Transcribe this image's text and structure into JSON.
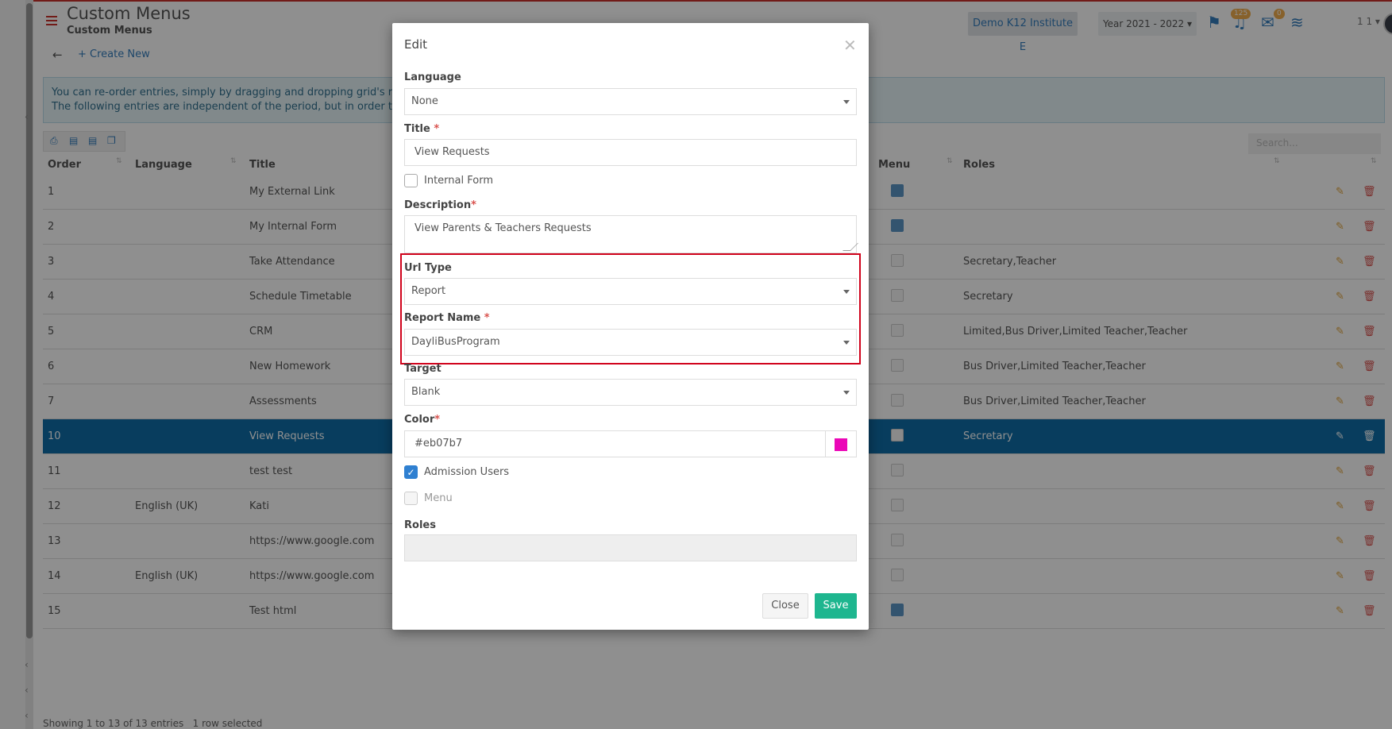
{
  "header": {
    "title": "Custom Menus",
    "subtitle": "Custom Menus",
    "institute": "Demo K12 Institute E",
    "year": "Year 2021 - 2022",
    "notif_count": "125",
    "mail_count": "0",
    "user_count": "1 1"
  },
  "toolbar": {
    "create_new": "Create New"
  },
  "info": {
    "line1": "You can re-order entries, simply by dragging and dropping grid's rows.",
    "line2": "The following entries are independent of the period, but in order to appea"
  },
  "search": {
    "placeholder": "Search..."
  },
  "grid": {
    "columns": [
      "Order",
      "Language",
      "Title",
      "Menu",
      "Roles"
    ],
    "rows": [
      {
        "order": "1",
        "language": "",
        "title": "My External Link",
        "menu": true,
        "roles": ""
      },
      {
        "order": "2",
        "language": "",
        "title": "My Internal Form",
        "menu": true,
        "roles": ""
      },
      {
        "order": "3",
        "language": "",
        "title": "Take Attendance",
        "menu": false,
        "roles": "Secretary,Teacher"
      },
      {
        "order": "4",
        "language": "",
        "title": "Schedule Timetable",
        "menu": false,
        "roles": "Secretary"
      },
      {
        "order": "5",
        "language": "",
        "title": "CRM",
        "menu": false,
        "roles": "Limited,Bus Driver,Limited Teacher,Teacher"
      },
      {
        "order": "6",
        "language": "",
        "title": "New Homework",
        "menu": false,
        "roles": "Bus Driver,Limited Teacher,Teacher"
      },
      {
        "order": "7",
        "language": "",
        "title": "Assessments",
        "menu": false,
        "roles": "Bus Driver,Limited Teacher,Teacher"
      },
      {
        "order": "10",
        "language": "",
        "title": "View Requests",
        "menu": false,
        "roles": "Secretary"
      },
      {
        "order": "11",
        "language": "",
        "title": "test test",
        "menu": false,
        "roles": ""
      },
      {
        "order": "12",
        "language": "English (UK)",
        "title": "Kati",
        "menu": false,
        "roles": ""
      },
      {
        "order": "13",
        "language": "",
        "title": "https://www.google.com",
        "menu": false,
        "roles": ""
      },
      {
        "order": "14",
        "language": "English (UK)",
        "title": "https://www.google.com",
        "menu": false,
        "roles": ""
      },
      {
        "order": "15",
        "language": "",
        "title": "Test html",
        "menu": true,
        "roles": ""
      }
    ],
    "footer": "Showing 1 to 13 of 13 entries",
    "selected": "1 row selected"
  },
  "modal": {
    "title": "Edit",
    "language_label": "Language",
    "language_value": "None",
    "title_label": "Title",
    "title_value": "View Requests",
    "internal_form_label": "Internal Form",
    "description_label": "Description",
    "description_value": "View Parents & Teachers Requests",
    "url_type_label": "Url Type",
    "url_type_value": "Report",
    "report_name_label": "Report Name",
    "report_name_value": "DayliBusProgram",
    "target_label": "Target",
    "target_value": "Blank",
    "color_label": "Color",
    "color_value": "#eb07b7",
    "admission_users_label": "Admission Users",
    "menu_label": "Menu",
    "roles_label": "Roles",
    "close_label": "Close",
    "save_label": "Save",
    "required_mark": "*"
  },
  "colors": {
    "accent": "#357ebd",
    "selected_row": "#0f6ea8",
    "save": "#1eb68f",
    "highlight": "#d0021b",
    "swatch": "#eb07b7"
  }
}
